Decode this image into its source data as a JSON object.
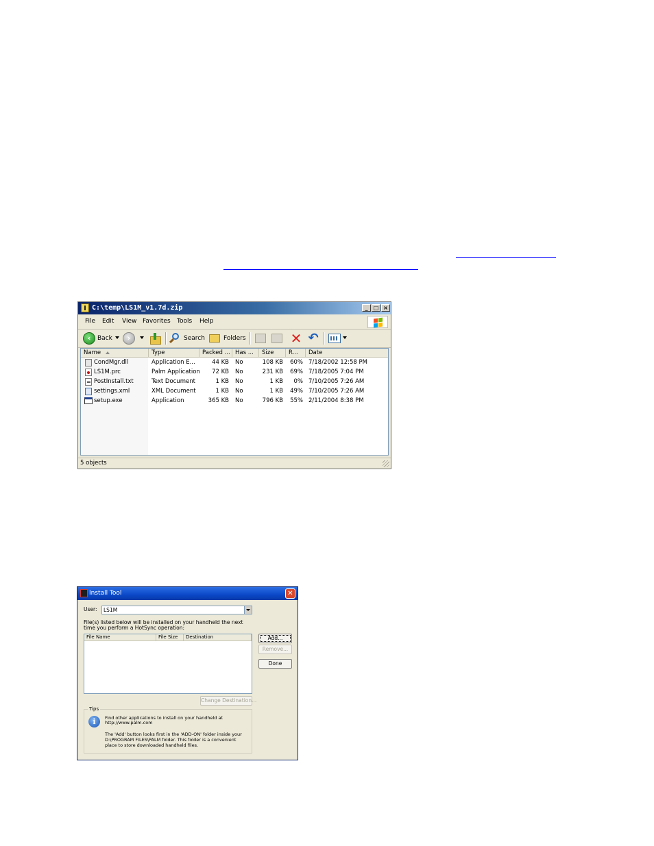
{
  "explorer": {
    "title": "C:\\temp\\LS1M_v1.7d.zip",
    "menu": [
      "File",
      "Edit",
      "View",
      "Favorites",
      "Tools",
      "Help"
    ],
    "toolbar": {
      "back_label": "Back",
      "search_label": "Search",
      "folders_label": "Folders"
    },
    "columns": [
      "Name",
      "Type",
      "Packed ...",
      "Has ...",
      "Size",
      "R...",
      "Date"
    ],
    "sort_column": "Name",
    "rows": [
      {
        "name": "CondMgr.dll",
        "type": "Application E...",
        "packed": "44 KB",
        "has": "No",
        "size": "108 KB",
        "ratio": "60%",
        "date": "7/18/2002 12:58 PM",
        "icon": "dll-file-icon"
      },
      {
        "name": "LS1M.prc",
        "type": "Palm Application",
        "packed": "72 KB",
        "has": "No",
        "size": "231 KB",
        "ratio": "69%",
        "date": "7/18/2005 7:04 PM",
        "icon": "palm-app-icon"
      },
      {
        "name": "PostInstall.txt",
        "type": "Text Document",
        "packed": "1 KB",
        "has": "No",
        "size": "1 KB",
        "ratio": "0%",
        "date": "7/10/2005 7:26 AM",
        "icon": "text-file-icon"
      },
      {
        "name": "settings.xml",
        "type": "XML Document",
        "packed": "1 KB",
        "has": "No",
        "size": "1 KB",
        "ratio": "49%",
        "date": "7/10/2005 7:26 AM",
        "icon": "xml-file-icon"
      },
      {
        "name": "setup.exe",
        "type": "Application",
        "packed": "365 KB",
        "has": "No",
        "size": "796 KB",
        "ratio": "55%",
        "date": "2/11/2004 8:38 PM",
        "icon": "exe-file-icon"
      }
    ],
    "status": "5 objects"
  },
  "install_tool": {
    "title": "Install Tool",
    "user_label": "User:",
    "user_value": "LS1M",
    "desc_line1": "File(s) listed below will be installed on your handheld the next",
    "desc_line2": "time you perform a HotSync operation:",
    "list_columns": [
      "File Name",
      "File Size",
      "Destination"
    ],
    "add_button": "Add...",
    "remove_button": "Remove...",
    "done_button": "Done",
    "change_destination_button": "Change Destination...",
    "tips_label": "Tips",
    "tip_line1": "Find other applications to install on your handheld at",
    "tip_line2": "http://www.palm.com",
    "tip_line3": "The 'Add' button looks first in the 'ADD-ON' folder inside your",
    "tip_line4": "D:\\PROGRAM FILES\\PALM folder. This folder is a convenient",
    "tip_line5": "place to store downloaded handheld files."
  },
  "colors": {
    "link": "#0000ff",
    "xp_face": "#ece9d8",
    "xp_title": "#0a48c8"
  }
}
